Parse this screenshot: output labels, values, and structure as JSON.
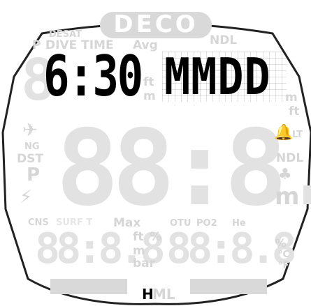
{
  "status": {
    "deco_label": "DECO",
    "desat_label": "DESAT",
    "p_label": "P",
    "dive_time_label": "DIVE TIME",
    "avg_label": "Avg",
    "ndl_label": "NDL",
    "ft_label": "ft",
    "m_label": "m"
  },
  "main": {
    "time_value": "6:30",
    "date_value": "MMDD"
  },
  "left_icons": {
    "ng_label": "NG",
    "dst_label": "DST",
    "p_label": "P"
  },
  "right_icons": {
    "lt_label": "LT",
    "ndl_label": "NDL",
    "m_label": "m"
  },
  "bottom": {
    "cns_label": "CNS",
    "surf_t_label": "SURF T",
    "max_label": "Max",
    "ft_label": "ft",
    "percent_label": "%",
    "m_label": "m",
    "bar_label": "bar",
    "otu_label": "OTU",
    "po2_label": "PO2",
    "he_label": "He",
    "pct2_label": "%",
    "c_label": "°C",
    "f_label": "°F"
  },
  "footer": {
    "h_label": "H",
    "ml_label": "ML"
  },
  "colors": {
    "active": "#000000",
    "inactive_segment": "#d9d9d9",
    "background": "#ffffff"
  }
}
